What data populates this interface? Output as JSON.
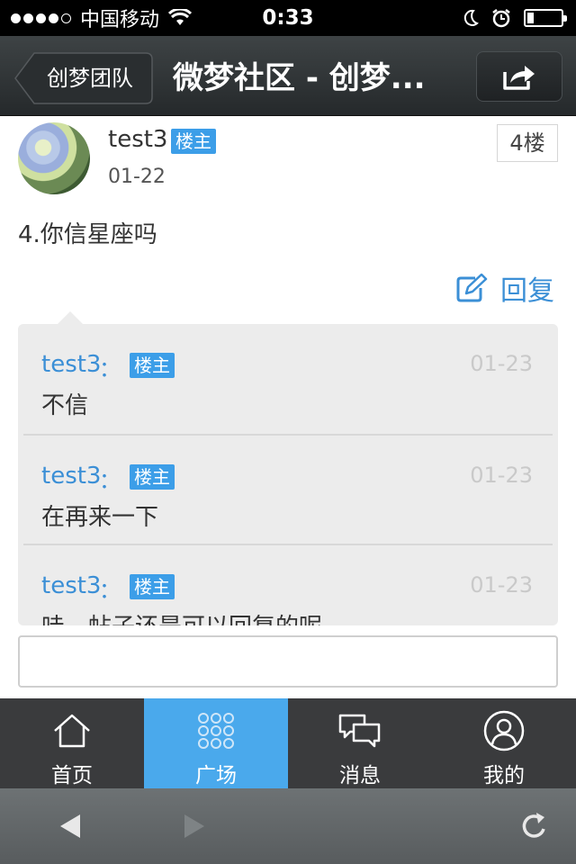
{
  "status_bar": {
    "carrier": "中国移动",
    "time": "0:33",
    "battery_level": 0.2
  },
  "nav": {
    "back_label": "创梦团队",
    "title": "微梦社区 - 创梦..."
  },
  "post": {
    "author": "test3",
    "op_badge": "楼主",
    "date": "01-22",
    "floor": "4楼",
    "content": "4.你信星座吗",
    "reply_label": "回复"
  },
  "replies": [
    {
      "user": "test3",
      "colon": "：",
      "badge": "楼主",
      "date": "01-23",
      "text": "不信"
    },
    {
      "user": "test3",
      "colon": "：",
      "badge": "楼主",
      "date": "01-23",
      "text": "在再来一下"
    },
    {
      "user": "test3",
      "colon": "：",
      "badge": "楼主",
      "date": "01-23",
      "text": "哇，帖子还是可以回复的呢"
    }
  ],
  "comment_input": {
    "value": "",
    "placeholder": ""
  },
  "tabs": [
    {
      "label": "首页",
      "icon": "home-icon",
      "active": false
    },
    {
      "label": "广场",
      "icon": "grid-icon",
      "active": true
    },
    {
      "label": "消息",
      "icon": "message-icon",
      "active": false
    },
    {
      "label": "我的",
      "icon": "profile-icon",
      "active": false
    }
  ],
  "colors": {
    "accent": "#3c9ee8",
    "link": "#3b8fd6",
    "active_tab": "#4aa9ec",
    "tabbar_bg": "#3a3b3d",
    "navbar_bg": "#2f3335"
  }
}
